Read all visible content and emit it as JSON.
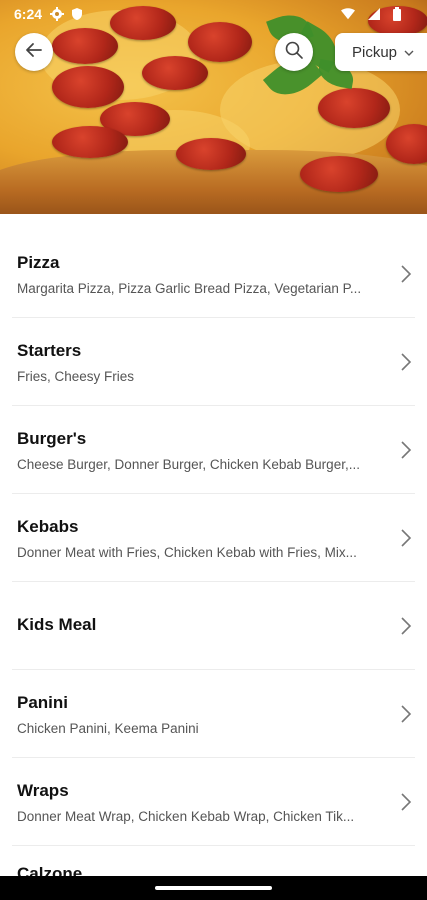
{
  "status_bar": {
    "time": "6:24",
    "icons": [
      "gear-icon",
      "shield-icon",
      "wifi-icon",
      "signal-icon",
      "battery-icon"
    ]
  },
  "header": {
    "pickup_label": "Pickup",
    "icons": [
      "back-arrow-icon",
      "search-icon",
      "chevron-down-icon"
    ]
  },
  "menu": {
    "categories": [
      {
        "title": "Pizza",
        "subtitle": "Margarita Pizza, Pizza Garlic Bread Pizza, Vegetarian P..."
      },
      {
        "title": "Starters",
        "subtitle": "Fries, Cheesy Fries"
      },
      {
        "title": "Burger's",
        "subtitle": "Cheese Burger, Donner Burger, Chicken Kebab Burger,..."
      },
      {
        "title": "Kebabs",
        "subtitle": "Donner Meat with Fries, Chicken Kebab with Fries, Mix..."
      },
      {
        "title": "Kids Meal",
        "subtitle": ""
      },
      {
        "title": "Panini",
        "subtitle": "Chicken Panini, Keema Panini"
      },
      {
        "title": "Wraps",
        "subtitle": "Donner Meat Wrap, Chicken Kebab Wrap, Chicken Tik..."
      }
    ],
    "partial_next": "Calzone"
  }
}
